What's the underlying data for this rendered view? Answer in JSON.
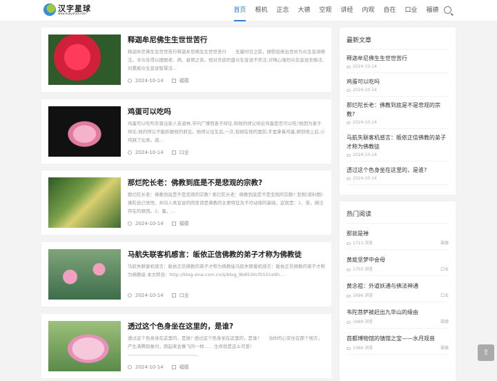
{
  "header": {
    "logo_name": "汉字星球",
    "logo_url": "www.huayanjcs.com",
    "nav": [
      "首页",
      "根机",
      "正念",
      "大德",
      "空观",
      "讲经",
      "内观",
      "自在",
      "口业",
      "福德"
    ],
    "active_nav": "首页",
    "accent": "#2f7bd6"
  },
  "articles": [
    {
      "title": "释迦牟尼佛生生世世苦行",
      "excerpt": "释迦牟尼佛生生世世苦行释迦牟尼佛生生世世苦行　　无量时日之前，摒慰如来出世并为众生宣讲佛法，令众生得以摆脱老、病、衰惘之苦。他对贪欲炽盛众生宣说不贪法;对嗔心强烈众生宣说无嗔法;对愚痴众生宣说智慧法...",
      "date": "2024-10-14",
      "category": "福德",
      "image": "red-flower"
    },
    {
      "title": "鸡蛋可以吃吗",
      "excerpt": "鸡蛋可以吃吗东晋出家人支道林,学问广博而善于辩论,和他的师父辩论鸡蛋是否可以吃?他因为善于辩论,他的师父不能折服他的邪见。他师父往生后,一次,现相在他的面前,手里拿着鸡蛋,掷到地上后,小鸡跳了出来。道...",
      "date": "2024-10-14",
      "category": "口业",
      "image": "lotus-dark"
    },
    {
      "title": "那烂陀长老：佛教到底是不是悲观的宗教?",
      "excerpt": "那烂陀长老：佛教到底是不是悲观的宗教? 那烂陀长老：佛教到底是不是悲观的宗教? 悲观(资料图)佛陀自己觉悟、并向人类宣说的四圣谛是佛教的主要特征及不可动摇的基础。这就是：1、苦，佛法存在的原因。2、集，...",
      "date": "2024-10-14",
      "category": "福德",
      "image": "trumpet-flowers"
    },
    {
      "title": "马航失联客机感言：皈依正信佛教的弟子才称为佛教徒",
      "excerpt": "马航失联客机感言：皈依正信佛教的弟子才称为佛教徒马航失联客机感言：皈依正信佛教的弟子才称为佛教徒 本文转自：http://blog.sina.com.cn/s/blog_9b8530cf0101e9h...",
      "date": "2024-10-14",
      "category": "口业",
      "image": "lotus-pond"
    },
    {
      "title": "透过这个色身坐在这里的，是谁?",
      "excerpt": "透过这个色身坐在这里的，是谁? 透过这个色身坐在这里的，是谁?　　当你的心安住在那个地方，产生满腾现象时，跑起来会像飞的一样...... 生命就是这么可爱!　———————————————...",
      "date": "2024-10-14",
      "category": "福德",
      "image": "pink-lotus"
    }
  ],
  "latest": {
    "title": "最新文章",
    "items": [
      {
        "title": "释迦牟尼佛生生世世苦行",
        "date": "2024-10-14"
      },
      {
        "title": "鸡蛋可以吃吗",
        "date": "2024-10-14"
      },
      {
        "title": "那烂陀长老：佛教到底是不是悲观的宗教?",
        "date": "2024-10-14"
      },
      {
        "title": "马航失联客机感言：皈依正信佛教的弟子才称为佛教徒",
        "date": "2024-10-14"
      },
      {
        "title": "透过这个色身坐在这里的，是谁?",
        "date": "2024-10-14"
      }
    ]
  },
  "popular": {
    "title": "热门阅读",
    "items": [
      {
        "title": "那就是禅",
        "views": "1713 浏览",
        "category": "福德"
      },
      {
        "title": "黄庭坚梦中会母",
        "views": "1703 浏览",
        "category": "口业"
      },
      {
        "title": "黄念祖：外道妖通与佛法神通",
        "views": "1696 浏览",
        "category": "口业"
      },
      {
        "title": "韦陀菩萨被赶出九华山的缘由",
        "views": "1689 浏览",
        "category": "福德"
      },
      {
        "title": "首都博物馆的镇馆之宝——水月观音",
        "views": "1366 浏览",
        "category": "福德"
      }
    ]
  },
  "icons": {
    "search": "search-icon",
    "back_to_top": "rocket-icon"
  }
}
